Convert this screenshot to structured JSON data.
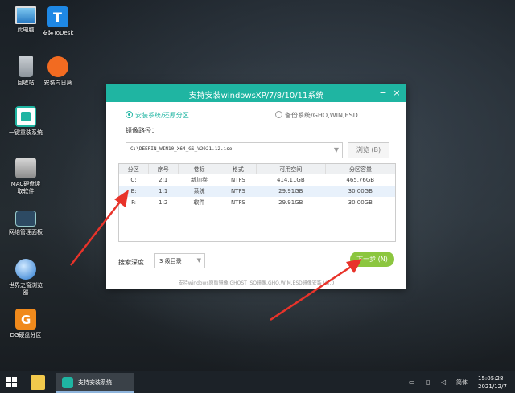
{
  "desktop": {
    "icons": [
      {
        "label": "此电脑"
      },
      {
        "label": "安装ToDesk"
      },
      {
        "label": "回收站"
      },
      {
        "label": "安装向日葵"
      },
      {
        "label": "一键重装系统"
      },
      {
        "label": "MAC硬盘读\n取软件"
      },
      {
        "label": "网络管理面板"
      },
      {
        "label": "世界之窗浏览\n器"
      },
      {
        "label": "DG硬盘分区"
      }
    ]
  },
  "window": {
    "title": "支持安装windowsXP/7/8/10/11系统",
    "minimize": "−",
    "close": "×",
    "mode_install": "安装系统/还原分区",
    "mode_backup": "备份系统/GHO,WIN,ESD",
    "path_label": "镜像路径：",
    "path_value": "C:\\DEEPIN_WIN10_X64_GS_V2021.12.iso",
    "browse": "浏览 (B)",
    "columns": [
      "分区",
      "序号",
      "卷标",
      "格式",
      "可用空间",
      "分区容量"
    ],
    "rows": [
      [
        "C:",
        "2:1",
        "新加卷",
        "NTFS",
        "414.11GB",
        "465.76GB"
      ],
      [
        "E:",
        "1:1",
        "系统",
        "NTFS",
        "29.91GB",
        "30.00GB"
      ],
      [
        "F:",
        "1:2",
        "软件",
        "NTFS",
        "29.91GB",
        "30.00GB"
      ]
    ],
    "depth_label": "搜索深度",
    "depth_value": "3 级目录",
    "next": "下一步 (N)",
    "footer": "支持windows原版镜像,GHOST ISO镜像,GHO,WIM,ESD镜像安装 V3.0"
  },
  "taskbar": {
    "app_label": "支持安装系统",
    "lang": "简体",
    "time": "15:05:28",
    "date": "2021/12/7"
  },
  "colors": {
    "accent": "#1fb5a2",
    "next_button": "#8cc63f",
    "arrow": "#e8332a"
  }
}
